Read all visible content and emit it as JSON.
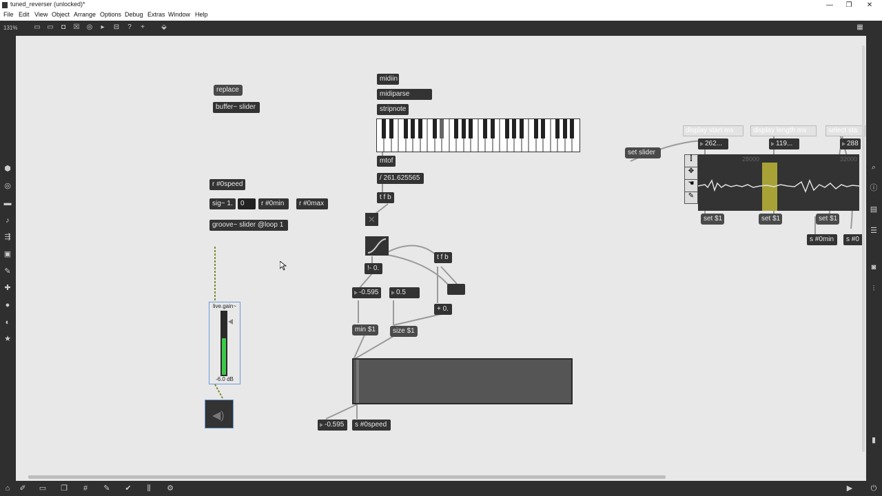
{
  "window": {
    "title": "tuned_reverser (unlocked)*",
    "controls": [
      "—",
      "❐",
      "✕"
    ]
  },
  "menu": [
    "File",
    "Edit",
    "View",
    "Object",
    "Arrange",
    "Options",
    "Debug",
    "Extras",
    "Window",
    "Help"
  ],
  "toolbar": {
    "zoom": "131%"
  },
  "objects": {
    "replace": "replace",
    "buffer": "buffer~ slider",
    "r_speed": "r #0speed",
    "sig": "sig~ 1.",
    "zero": "0",
    "r_min": "r #0min",
    "r_max": "r #0max",
    "groove": "groove~ slider @loop 1",
    "live_gain_label": "live.gain~",
    "live_gain_value": "-6.0 dB",
    "midiin": "midiin",
    "midiparse": "midiparse",
    "stripnote": "stripnote",
    "mtof": "mtof",
    "divide": "/ 261.625565",
    "tfb1": "t f b",
    "subtract": "!- 0.",
    "num_neg": "-0.595",
    "num_half": "0.5",
    "tfb2": "t f b",
    "add": "+ 0.",
    "min": "min $1",
    "size": "size $1",
    "num_out": "-0.595",
    "s_speed": "s #0speed",
    "set_slider": "set slider",
    "display_start": "display start ms",
    "display_length": "display length ms",
    "select_start": "select sta",
    "num_start": "262...",
    "num_length": "119...",
    "num_sel": "288",
    "set1a": "set $1",
    "set1b": "set $1",
    "set1c": "set $1",
    "s_min": "s #0min",
    "s_0": "s #0",
    "wave_tick1": "28000",
    "wave_tick2": "32000"
  }
}
